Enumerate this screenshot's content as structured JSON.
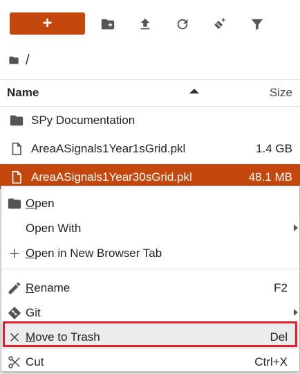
{
  "toolbar": {
    "new_label": "+",
    "icons": [
      "new-folder-icon",
      "upload-icon",
      "refresh-icon",
      "git-clone-icon",
      "filter-icon"
    ]
  },
  "breadcrumb": {
    "path": "/"
  },
  "file_list": {
    "columns": {
      "name": "Name",
      "size": "Size"
    },
    "rows": [
      {
        "name": "SPy Documentation",
        "size": "",
        "type": "folder"
      },
      {
        "name": "AreaASignals1Year1sGrid.pkl",
        "size": "1.4 GB",
        "type": "file"
      },
      {
        "name": "AreaASignals1Year30sGrid.pkl",
        "size": "48.1 MB",
        "type": "file",
        "selected": true
      }
    ]
  },
  "context_menu": {
    "items": [
      {
        "label": "Open",
        "mnemonic": "O",
        "rest": "pen",
        "shortcut": ""
      },
      {
        "label": "Open With",
        "shortcut": ""
      },
      {
        "label": "Open in New Browser Tab",
        "mnemonic": "O",
        "rest": "pen in New Browser Tab",
        "shortcut": ""
      },
      {
        "label": "Rename",
        "mnemonic": "R",
        "rest": "ename",
        "shortcut": "F2"
      },
      {
        "label": "Git",
        "shortcut": ""
      },
      {
        "label": "Move to Trash",
        "mnemonic": "M",
        "rest": "ove to Trash",
        "shortcut": "Del"
      },
      {
        "label": "Cut",
        "shortcut": "Ctrl+X"
      }
    ]
  },
  "colors": {
    "accent": "#c4480e",
    "highlight_box": "#e01e2a"
  }
}
